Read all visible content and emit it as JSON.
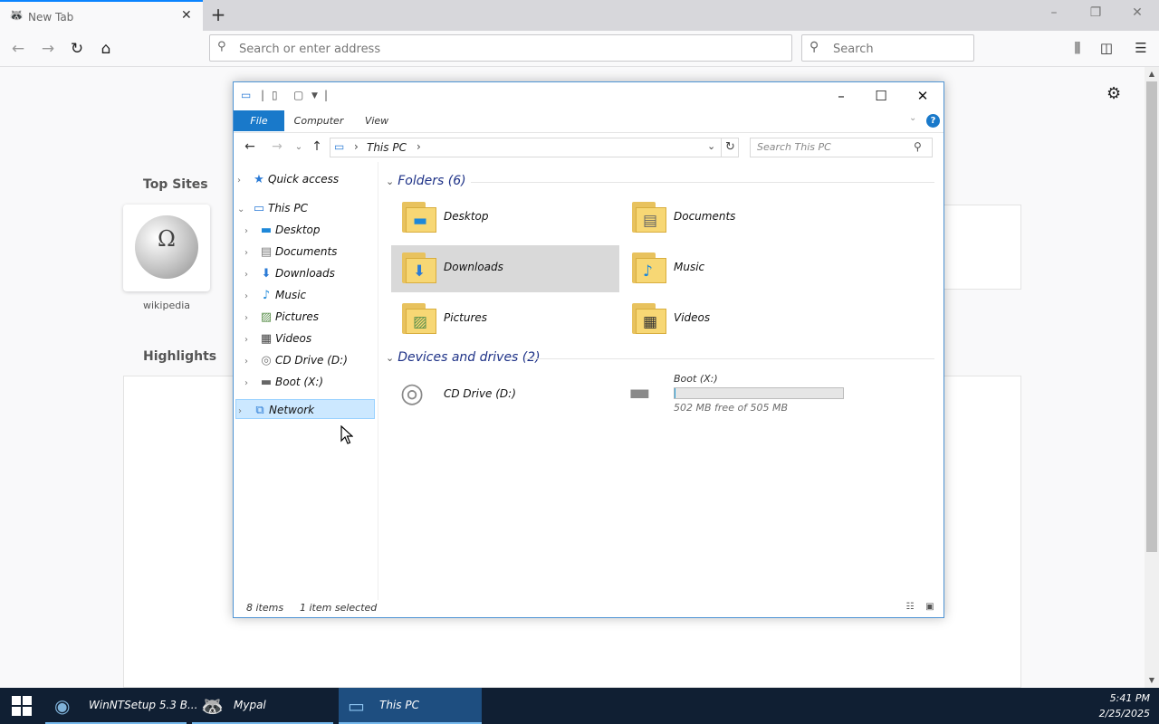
{
  "browser": {
    "tab_title": "New Tab",
    "tab_favicon": "raccoon-icon",
    "new_tab_symbol": "+",
    "url_placeholder": "Search or enter address",
    "search_placeholder": "Search",
    "accent": "#0a84ff"
  },
  "newtab_page": {
    "top_sites_heading": "Top Sites",
    "top_site_label": "wikipedia",
    "top_site_glyph": "Ω",
    "highlights_heading": "Highlights"
  },
  "explorer": {
    "ribbon_tabs": [
      "File",
      "Computer",
      "View"
    ],
    "help_symbol": "?",
    "address_crumb": "This PC",
    "search_placeholder": "Search This PC",
    "nav_tree": [
      {
        "label": "Quick access",
        "icon": "star-icon"
      },
      {
        "label": "This PC",
        "icon": "computer-icon"
      },
      {
        "label": "Desktop",
        "icon": "desktop-icon"
      },
      {
        "label": "Documents",
        "icon": "documents-icon"
      },
      {
        "label": "Downloads",
        "icon": "download-arrow-icon"
      },
      {
        "label": "Music",
        "icon": "music-note-icon"
      },
      {
        "label": "Pictures",
        "icon": "pictures-icon"
      },
      {
        "label": "Videos",
        "icon": "film-icon"
      },
      {
        "label": "CD Drive (D:)",
        "icon": "cd-drive-icon"
      },
      {
        "label": "Boot (X:)",
        "icon": "drive-icon"
      },
      {
        "label": "Network",
        "icon": "network-icon"
      }
    ],
    "folders_heading": "Folders (6)",
    "folders": [
      {
        "label": "Desktop",
        "icon": "desktop-icon"
      },
      {
        "label": "Documents",
        "icon": "documents-icon"
      },
      {
        "label": "Downloads",
        "icon": "download-arrow-icon"
      },
      {
        "label": "Music",
        "icon": "music-note-icon"
      },
      {
        "label": "Pictures",
        "icon": "pictures-icon"
      },
      {
        "label": "Videos",
        "icon": "film-icon"
      }
    ],
    "devices_heading": "Devices and drives (2)",
    "drives": [
      {
        "label": "CD Drive (D:)",
        "icon": "cd-drive-icon"
      },
      {
        "label": "Boot (X:)",
        "icon": "drive-icon",
        "free_text": "502 MB free of 505 MB",
        "used_fraction": 0.006
      }
    ],
    "status_items": "8 items",
    "status_selected": "1 item selected",
    "selection_color": "#d9d9d9",
    "ribbon_accent": "#1979ca"
  },
  "taskbar": {
    "items": [
      {
        "label": "WinNTSetup 5.3 B...",
        "icon": "installer-disc-icon"
      },
      {
        "label": "Mypal",
        "icon": "raccoon-icon"
      },
      {
        "label": "This PC",
        "icon": "computer-icon"
      }
    ],
    "time": "5:41 PM",
    "date": "2/25/2025",
    "color": "#101f33"
  }
}
